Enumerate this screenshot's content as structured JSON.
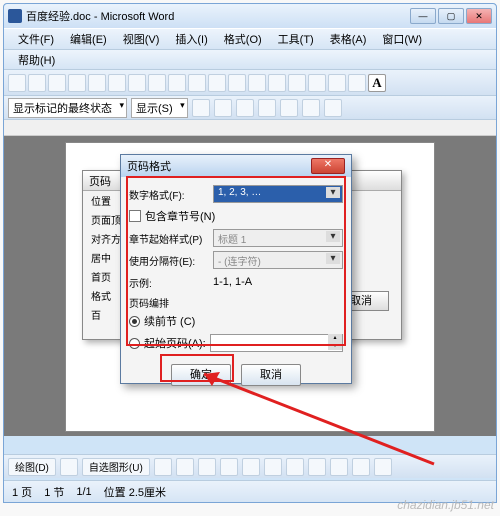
{
  "window": {
    "title": "百度经验.doc - Microsoft Word",
    "min": "—",
    "max": "▢",
    "close": "✕"
  },
  "menu": {
    "file": "文件(F)",
    "edit": "编辑(E)",
    "view": "视图(V)",
    "insert": "插入(I)",
    "format": "格式(O)",
    "tools": "工具(T)",
    "table": "表格(A)",
    "window": "窗口(W)",
    "help": "帮助(H)"
  },
  "markbar": {
    "state": "显示标记的最终状态",
    "show": "显示(S)",
    "a": "A"
  },
  "bgdlg": {
    "title": "页码",
    "pos": "位置",
    "align": "页面顶",
    "just": "对齐方",
    "center": "居中",
    "first": "首页",
    "fmt": "格式",
    "cancel": "取消",
    "bai": "百"
  },
  "dlg": {
    "title": "页码格式",
    "numfmt_lbl": "数字格式(F):",
    "numfmt_val": "1, 2, 3, …",
    "incchap": "包含章节号(N)",
    "chapstyle_lbl": "章节起始样式(P)",
    "chapstyle_val": "标题 1",
    "sep_lbl": "使用分隔符(E):",
    "sep_val": "- (连字符)",
    "example_lbl": "示例:",
    "example_val": "1-1, 1-A",
    "section": "页码编排",
    "cont": "续前节 (C)",
    "start": "起始页码(A):",
    "ok": "确定",
    "cancel": "取消"
  },
  "draw": {
    "menu": "绘图(D)",
    "autoshape": "自选图形(U)"
  },
  "status": {
    "page": "1 页",
    "sec": "1 节",
    "pages": "1/1",
    "pos": "位置 2.5厘米"
  },
  "watermark": "chazidian.jb51.net"
}
